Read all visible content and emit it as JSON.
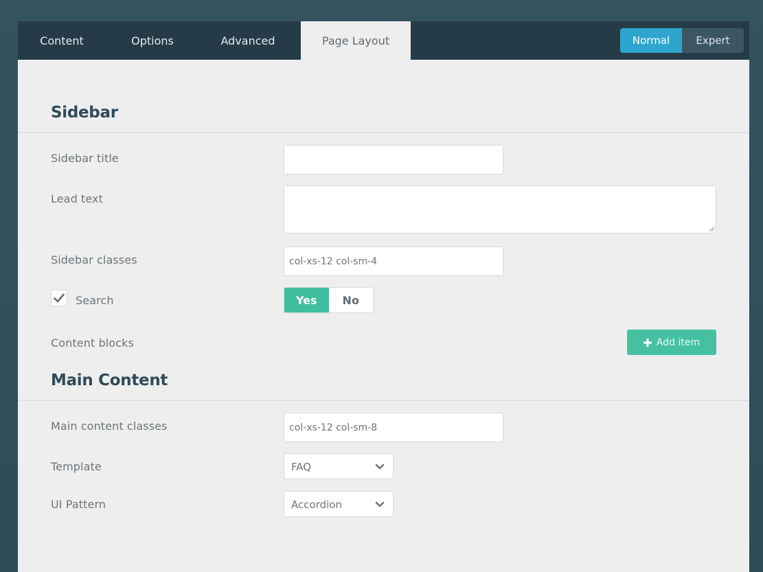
{
  "tabs": [
    {
      "label": "Content"
    },
    {
      "label": "Options"
    },
    {
      "label": "Advanced"
    },
    {
      "label": "Page Layout",
      "active": true
    }
  ],
  "mode": {
    "normal_label": "Normal",
    "expert_label": "Expert",
    "selected": "Normal"
  },
  "sidebar": {
    "title": "Sidebar",
    "sidebar_title_label": "Sidebar title",
    "sidebar_title_value": "",
    "lead_text_label": "Lead text",
    "lead_text_value": "",
    "classes_label": "Sidebar classes",
    "classes_value": "col-xs-12 col-sm-4",
    "search_label": "Search",
    "search_checked": true,
    "search_yes": "Yes",
    "search_no": "No",
    "search_selected": "Yes",
    "content_blocks_label": "Content blocks",
    "add_item_label": "Add item"
  },
  "main_content": {
    "title": "Main Content",
    "classes_label": "Main content classes",
    "classes_value": "col-xs-12 col-sm-8",
    "template_label": "Template",
    "template_value": "FAQ",
    "ui_pattern_label": "UI Pattern",
    "ui_pattern_value": "Accordion"
  },
  "icons": {
    "checkbox": "checkmark-icon",
    "add": "plus-icon",
    "select": "chevron-down-icon",
    "resize": "resize-grip-icon"
  },
  "colors": {
    "accent_blue": "#2ea5cc",
    "accent_green": "#3fbf9f",
    "header_bg": "#253c48",
    "panel_bg": "#eeeeee"
  }
}
